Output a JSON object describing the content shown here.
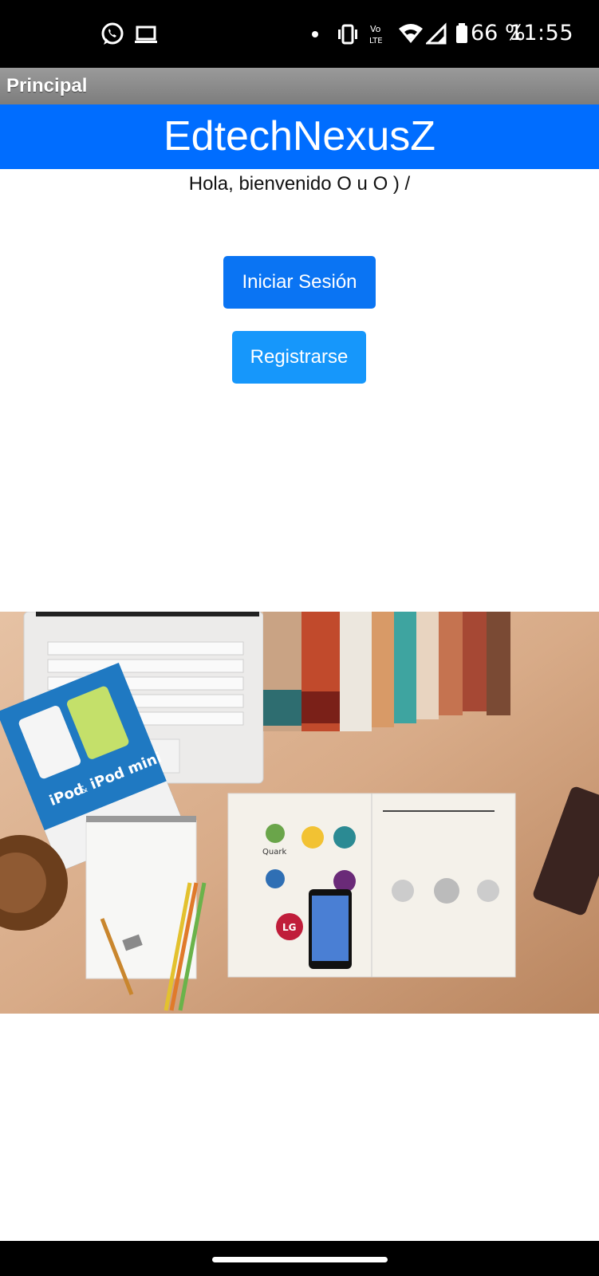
{
  "status_bar": {
    "time": "11:55",
    "battery": "66 %",
    "network": "LTE",
    "icons": [
      "whatsapp-icon",
      "laptop-icon",
      "notification-dot-icon",
      "vibrate-icon",
      "volte-icon",
      "wifi-icon",
      "signal-icon",
      "battery-icon"
    ]
  },
  "titlebar": {
    "title": "Principal"
  },
  "header": {
    "title": "EdtechNexusZ",
    "color": "#006dff"
  },
  "main": {
    "welcome": "Hola, bienvenido O u O ) /",
    "login_label": "Iniciar Sesión",
    "register_label": "Registrarse",
    "login_color": "#0a74f3",
    "register_color": "#1697fb"
  },
  "hero": {
    "icon": "desk-workspace-photo",
    "texts": {
      "ipod": "iPod",
      "and": "&",
      "ipod_mini": "iPod mini",
      "quark": "Quark",
      "lg": "LG"
    }
  },
  "nav_bar": {
    "icon": "home-handle-icon"
  }
}
